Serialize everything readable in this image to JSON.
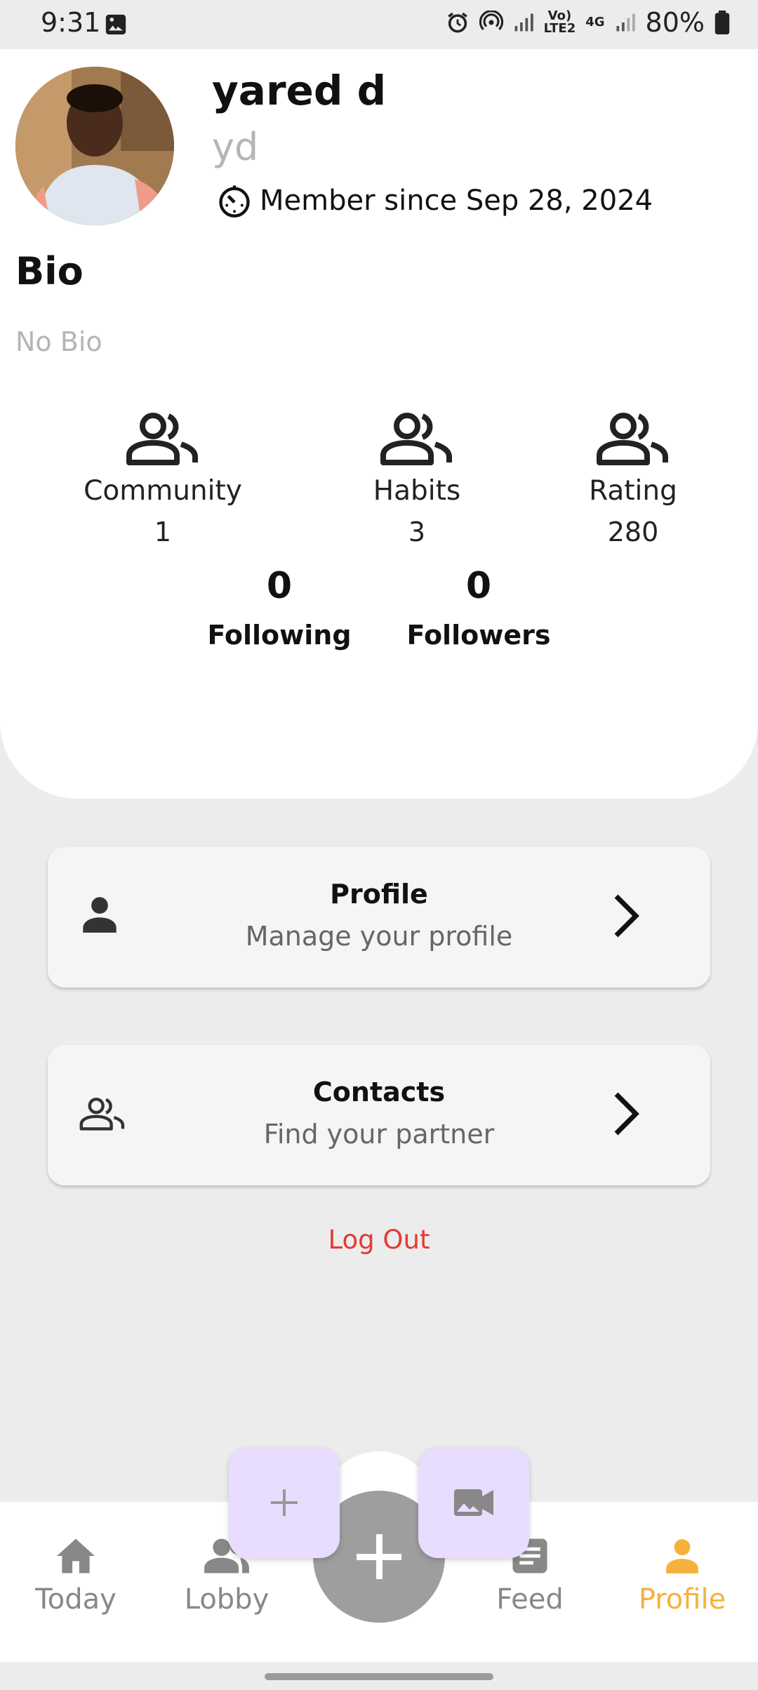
{
  "status_bar": {
    "time": "9:31",
    "network_top": "Vo)",
    "network_bottom": "LTE2",
    "net_type": "4G",
    "battery": "80%"
  },
  "profile": {
    "name": "yared d",
    "username": "yd",
    "member_since": "Member since Sep 28, 2024",
    "bio_title": "Bio",
    "bio_text": "No Bio"
  },
  "stats": [
    {
      "label": "Community",
      "value": "1",
      "icon": "people-icon"
    },
    {
      "label": "Habits",
      "value": "3",
      "icon": "people-icon"
    },
    {
      "label": "Rating",
      "value": "280",
      "icon": "people-icon"
    }
  ],
  "follow": {
    "following_count": "0",
    "following_label": "Following",
    "followers_count": "0",
    "followers_label": "Followers"
  },
  "menu": [
    {
      "title": "Profile",
      "subtitle": "Manage your profile",
      "icon": "person-icon"
    },
    {
      "title": "Contacts",
      "subtitle": "Find your partner",
      "icon": "people-outline-icon"
    }
  ],
  "logout_label": "Log Out",
  "nav": [
    {
      "label": "Today",
      "icon": "home-icon"
    },
    {
      "label": "Lobby",
      "icon": "group-icon"
    },
    {
      "label": "Feed",
      "icon": "article-icon"
    },
    {
      "label": "Profile",
      "icon": "person-icon",
      "active": true
    }
  ],
  "colors": {
    "accent": "#f6b13d",
    "logout": "#e53935",
    "mini_button": "#e8dcff",
    "fab": "#9e9e9e"
  }
}
